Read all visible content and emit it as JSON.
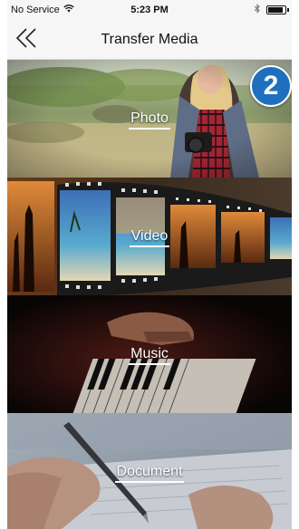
{
  "status_bar": {
    "carrier": "No Service",
    "time": "5:23 PM",
    "wifi_icon": "wifi-icon",
    "bluetooth_icon": "bluetooth-icon",
    "battery_icon": "battery-icon"
  },
  "nav": {
    "title": "Transfer Media",
    "back_icon": "double-chevron-left-icon"
  },
  "categories": [
    {
      "label": "Photo"
    },
    {
      "label": "Video"
    },
    {
      "label": "Music"
    },
    {
      "label": "Document"
    }
  ],
  "badge": {
    "text": "2",
    "color": "#1f6fbf"
  },
  "colors": {
    "bar_bg": "#f6f6f6",
    "label_text": "#ffffff"
  }
}
